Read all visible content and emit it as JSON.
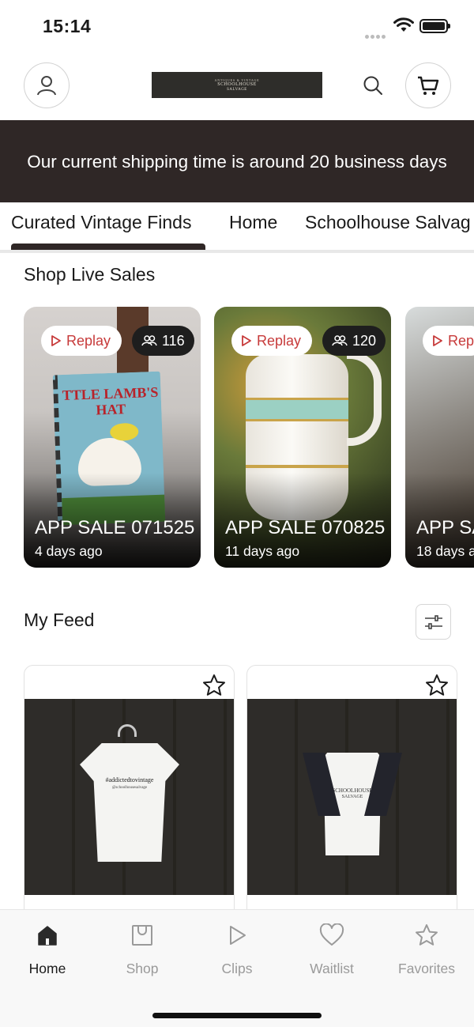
{
  "status_bar": {
    "time": "15:14"
  },
  "header": {
    "logo": {
      "top": "ANTIQUES & VINTAGE",
      "main": "SCHOOLHOUSE",
      "sub": "SALVAGE"
    }
  },
  "banner": {
    "text": "Our current shipping time is around 20 business days"
  },
  "tabs": [
    {
      "label": "Curated Vintage Finds",
      "active": true
    },
    {
      "label": "Home",
      "active": false
    },
    {
      "label": "Schoolhouse Salvag",
      "active": false
    }
  ],
  "live_sales": {
    "title": "Shop Live Sales",
    "cards": [
      {
        "replay_label": "Replay",
        "viewers": "116",
        "title": "APP SALE 071525",
        "ago": "4 days ago"
      },
      {
        "replay_label": "Replay",
        "viewers": "120",
        "title": "APP SALE 070825",
        "ago": "11 days ago"
      },
      {
        "replay_label": "Rep",
        "viewers": "",
        "title": "APP SA",
        "ago": "18 days a"
      }
    ]
  },
  "feed": {
    "title": "My Feed",
    "items": [
      {
        "shirt_text": "#addictedtovintage",
        "shirt_sub": "@schoolhousesalvage"
      },
      {
        "shirt_text": "SCHOOLHOUSE",
        "shirt_sub": "SALVAGE"
      }
    ]
  },
  "book_cover": {
    "line1": "TTLE LAMB'S",
    "line2": "HAT"
  },
  "bottom_nav": [
    {
      "label": "Home",
      "icon": "home-icon",
      "active": true
    },
    {
      "label": "Shop",
      "icon": "shopping-bag-icon",
      "active": false
    },
    {
      "label": "Clips",
      "icon": "play-icon",
      "active": false
    },
    {
      "label": "Waitlist",
      "icon": "heart-icon",
      "active": false
    },
    {
      "label": "Favorites",
      "icon": "star-icon",
      "active": false
    }
  ],
  "colors": {
    "banner_bg": "#2f2726",
    "replay_text": "#c73a3a",
    "active_tab_bar": "#2f2726"
  }
}
